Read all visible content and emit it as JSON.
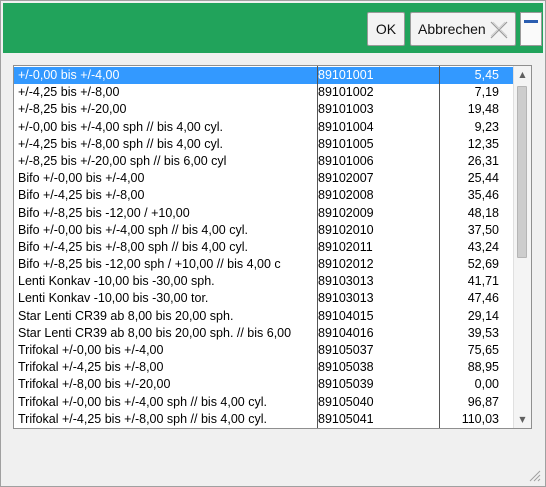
{
  "toolbar": {
    "ok_label": "OK",
    "cancel_label": "Abbrechen",
    "accent_color": "#21a35b"
  },
  "list": {
    "selected_index": 0,
    "rows": [
      {
        "desc": "+/-0,00 bis +/-4,00",
        "code": "89101001",
        "price": "5,45"
      },
      {
        "desc": "+/-4,25 bis +/-8,00",
        "code": "89101002",
        "price": "7,19"
      },
      {
        "desc": "+/-8,25 bis +/-20,00",
        "code": "89101003",
        "price": "19,48"
      },
      {
        "desc": "+/-0,00 bis +/-4,00 sph // bis 4,00 cyl.",
        "code": "89101004",
        "price": "9,23"
      },
      {
        "desc": "+/-4,25 bis +/-8,00 sph // bis 4,00 cyl.",
        "code": "89101005",
        "price": "12,35"
      },
      {
        "desc": "+/-8,25 bis +/-20,00 sph // bis 6,00 cyl",
        "code": "89101006",
        "price": "26,31"
      },
      {
        "desc": "Bifo +/-0,00 bis +/-4,00",
        "code": "89102007",
        "price": "25,44"
      },
      {
        "desc": "Bifo +/-4,25 bis +/-8,00",
        "code": "89102008",
        "price": "35,46"
      },
      {
        "desc": "Bifo +/-8,25 bis -12,00 / +10,00",
        "code": "89102009",
        "price": "48,18"
      },
      {
        "desc": "Bifo +/-0,00 bis +/-4,00 sph // bis 4,00 cyl.",
        "code": "89102010",
        "price": "37,50"
      },
      {
        "desc": "Bifo +/-4,25 bis +/-8,00 sph // bis 4,00 cyl.",
        "code": "89102011",
        "price": "43,24"
      },
      {
        "desc": "Bifo +/-8,25 bis -12,00 sph / +10,00 // bis 4,00 c",
        "code": "89102012",
        "price": "52,69"
      },
      {
        "desc": "Lenti Konkav -10,00 bis -30,00 sph.",
        "code": "89103013",
        "price": "41,71"
      },
      {
        "desc": "Lenti Konkav -10,00 bis -30,00 tor.",
        "code": "89103013",
        "price": "47,46"
      },
      {
        "desc": "Star Lenti CR39 ab 8,00 bis 20,00 sph.",
        "code": "89104015",
        "price": "29,14"
      },
      {
        "desc": "Star Lenti CR39 ab 8,00 bis 20,00 sph. // bis 6,00",
        "code": "89104016",
        "price": "39,53"
      },
      {
        "desc": "Trifokal +/-0,00 bis +/-4,00",
        "code": "89105037",
        "price": "75,65"
      },
      {
        "desc": "Trifokal +/-4,25 bis +/-8,00",
        "code": "89105038",
        "price": "88,95"
      },
      {
        "desc": "Trifokal +/-8,00 bis +/-20,00",
        "code": "89105039",
        "price": "0,00"
      },
      {
        "desc": "Trifokal +/-0,00 bis +/-4,00 sph // bis 4,00 cyl.",
        "code": "89105040",
        "price": "96,87"
      },
      {
        "desc": "Trifokal +/-4,25 bis +/-8,00 sph // bis 4,00 cyl.",
        "code": "89105041",
        "price": "110,03"
      }
    ]
  }
}
